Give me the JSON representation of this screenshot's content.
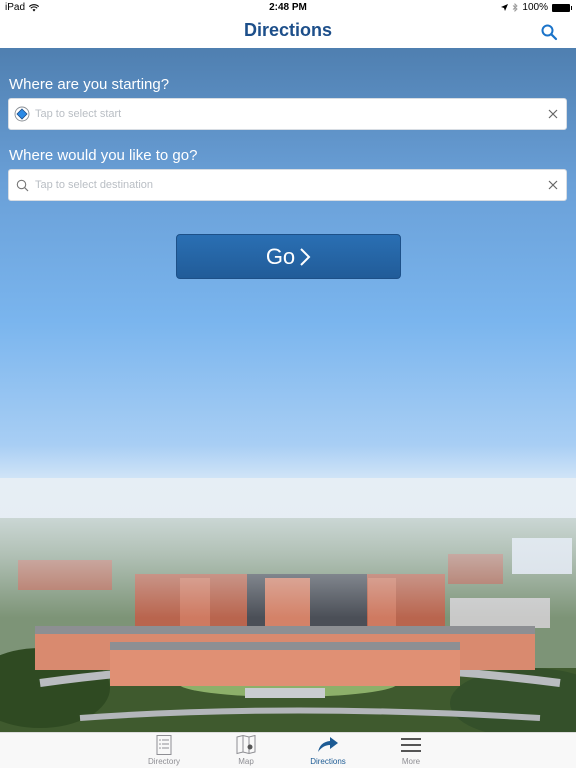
{
  "status_bar": {
    "device": "iPad",
    "time": "2:48 PM",
    "battery": "100%"
  },
  "nav": {
    "title": "Directions",
    "search_icon": "search-icon"
  },
  "form": {
    "start_label": "Where are you starting?",
    "start_placeholder": "Tap to select start",
    "start_value": "",
    "start_icon": "location-target-icon",
    "destination_label": "Where would you like to go?",
    "destination_placeholder": "Tap to select destination",
    "destination_value": "",
    "destination_icon": "search-icon",
    "clear_icon": "close-icon",
    "go_label": "Go"
  },
  "tabs": [
    {
      "label": "Directory",
      "icon": "list-icon",
      "active": false
    },
    {
      "label": "Map",
      "icon": "map-icon",
      "active": false
    },
    {
      "label": "Directions",
      "icon": "directions-arrow-icon",
      "active": true
    },
    {
      "label": "More",
      "icon": "menu-icon",
      "active": false
    }
  ],
  "colors": {
    "brand": "#1d4f8a",
    "active_tab": "#1d5b94",
    "inactive_tab": "#8e8e93",
    "go_button": "#245f9e"
  }
}
